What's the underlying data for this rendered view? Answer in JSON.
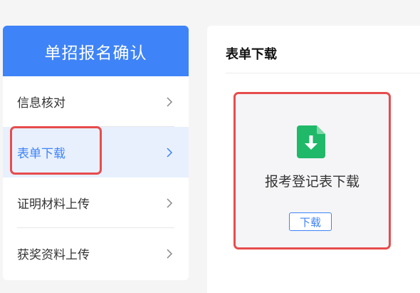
{
  "sidebar": {
    "header": "单招报名确认",
    "items": [
      {
        "label": "信息核对"
      },
      {
        "label": "表单下载"
      },
      {
        "label": "证明材料上传"
      },
      {
        "label": "获奖资料上传"
      }
    ]
  },
  "main": {
    "title": "表单下载",
    "card": {
      "title": "报考登记表下载",
      "button_label": "下载",
      "icon": "file-download-icon"
    }
  },
  "colors": {
    "accent": "#3e83f7",
    "active_bg": "#e8f0fe",
    "highlight": "#e74c4c",
    "file_icon": "#20b869"
  }
}
